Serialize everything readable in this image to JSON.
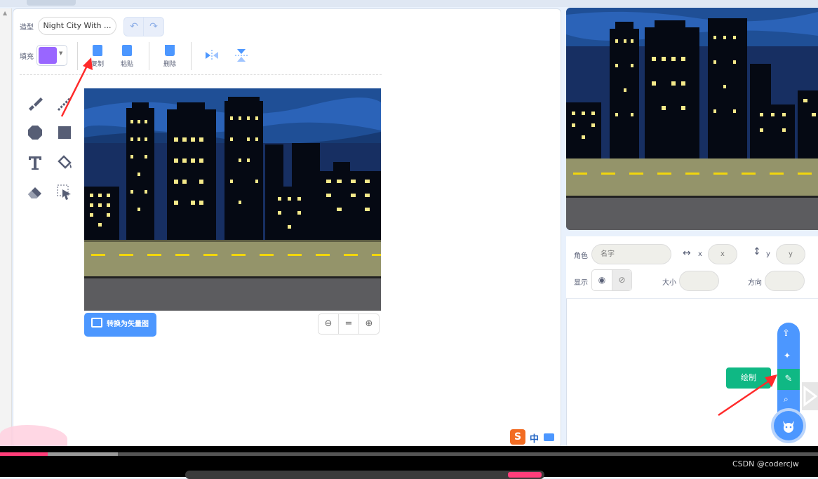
{
  "editor": {
    "costume_label": "造型",
    "costume_name": "Night City With ...",
    "fill_label": "填充",
    "fill_color": "#9966ff",
    "toolbar": {
      "copy_label": "复制",
      "paste_label": "粘贴",
      "delete_label": "删除"
    },
    "convert_button": "转换为矢量图",
    "zoom_reset": "="
  },
  "tools": [
    "brush-icon",
    "line-icon",
    "circle-icon",
    "rectangle-icon",
    "text-icon",
    "fill-icon",
    "eraser-icon",
    "select-icon"
  ],
  "sprite": {
    "role_label": "角色",
    "name_placeholder": "名字",
    "x_label": "x",
    "x_placeholder": "x",
    "y_label": "y",
    "y_placeholder": "y",
    "show_label": "显示",
    "size_label": "大小",
    "direction_label": "方向"
  },
  "draw_tooltip": "绘制",
  "ime": {
    "s_label": "S",
    "mode": "中"
  },
  "watermark": "CSDN @codercjw",
  "colors": {
    "accent": "#4c97ff",
    "green": "#0fb884",
    "annotation_red": "#ff2a2a",
    "sky": "#1f4f96",
    "road": "#94946a",
    "lane": "#f2d60c"
  }
}
